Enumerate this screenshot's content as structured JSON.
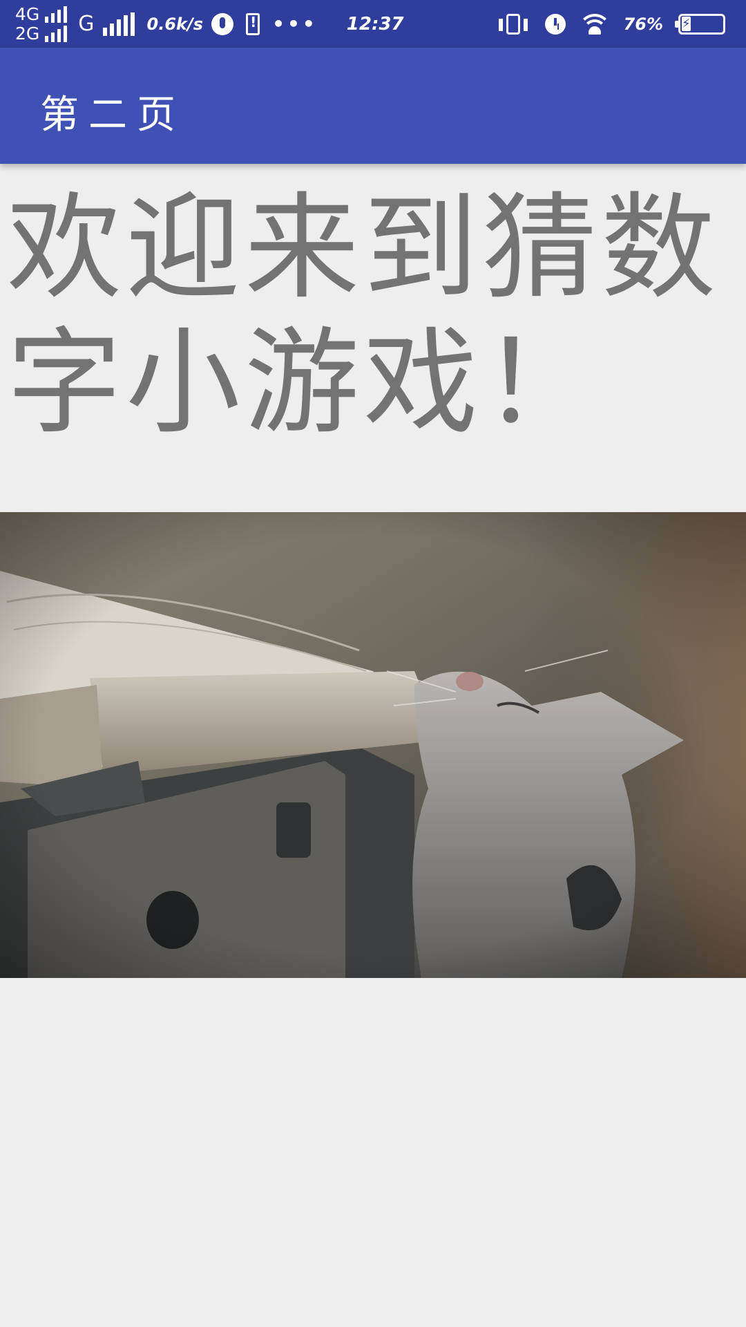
{
  "status_bar": {
    "network_1": "4G",
    "network_2": "2G",
    "network_3": "G",
    "speed": "0.6k/s",
    "more_icon": "more-dots-icon",
    "time": "12:37",
    "battery_percent": "76%",
    "battery_level": 0.76,
    "icons": [
      "signal-icon",
      "vpn-icon",
      "alert-phone-icon",
      "vibrate-icon",
      "alarm-icon",
      "wifi-icon",
      "battery-charging-icon"
    ]
  },
  "app_bar": {
    "title": "第二页",
    "background": "#3f51b5"
  },
  "main": {
    "welcome_text": "欢迎来到猜数字小游戏！",
    "image": "cat-with-book-photo"
  },
  "colors": {
    "status_bar": "#2f3d9c",
    "page_background": "#eeeeef",
    "text": "#737373"
  }
}
